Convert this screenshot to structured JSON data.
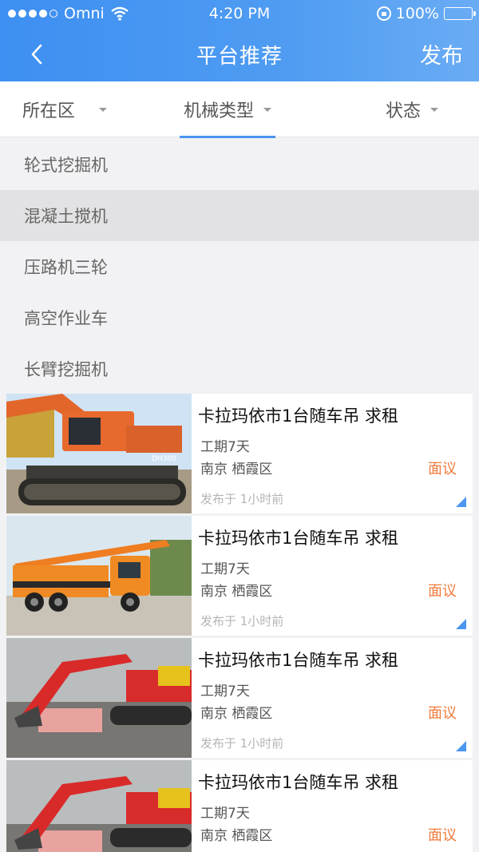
{
  "status_bar": {
    "carrier": "Omni",
    "time": "4:20 PM",
    "battery": "100%"
  },
  "nav": {
    "title": "平台推荐",
    "publish_label": "发布"
  },
  "filters": [
    {
      "label": "所在区"
    },
    {
      "label": "机械类型"
    },
    {
      "label": "状态"
    }
  ],
  "dropdown": {
    "items": [
      {
        "label": "轮式挖掘机"
      },
      {
        "label": "混凝土搅机"
      },
      {
        "label": "压路机三轮"
      },
      {
        "label": "高空作业车"
      },
      {
        "label": "长臂挖掘机"
      }
    ],
    "active": "混凝土搅机"
  },
  "listings": [
    {
      "title": "卡拉玛依市1台随车吊 求租",
      "period": "工期7天",
      "location": "南京 栖霞区",
      "price": "面议",
      "posted": "发布于 1小时前",
      "image": "orange-excavator"
    },
    {
      "title": "卡拉玛依市1台随车吊 求租",
      "period": "工期7天",
      "location": "南京 栖霞区",
      "price": "面议",
      "posted": "发布于 1小时前",
      "image": "truck-crane"
    },
    {
      "title": "卡拉玛依市1台随车吊 求租",
      "period": "工期7天",
      "location": "南京 栖霞区",
      "price": "面议",
      "posted": "发布于 1小时前",
      "image": "red-excavator"
    },
    {
      "title": "卡拉玛依市1台随车吊 求租",
      "period": "工期7天",
      "location": "南京 栖霞区",
      "price": "面议",
      "posted": "",
      "image": "red-excavator"
    }
  ],
  "colors": {
    "accent": "#4a96f0",
    "price": "#f07a3a",
    "header_start": "#3d8ff1",
    "header_end": "#6aacf4"
  }
}
